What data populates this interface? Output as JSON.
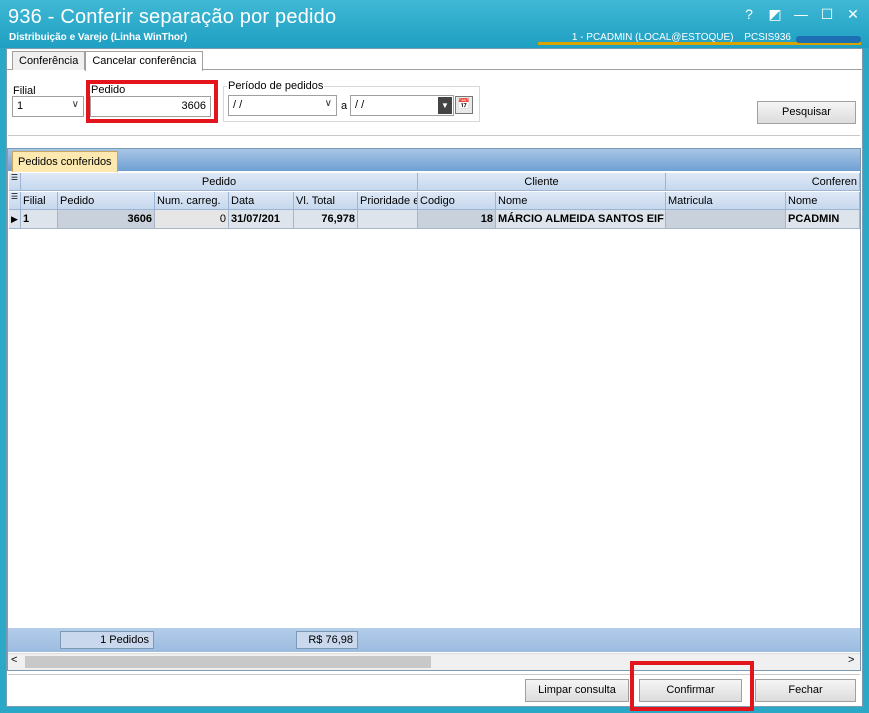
{
  "window": {
    "title": "936 - Conferir separação por pedido",
    "subtitle": "Distribuição e Varejo (Linha WinThor)",
    "user": "1 - PCADMIN (LOCAL@ESTOQUE)",
    "routine": "PCSIS936",
    "controls": {
      "help": "?",
      "restore": "◩",
      "minimize": "—",
      "maximize": "☐",
      "close": "✕"
    }
  },
  "tabs": [
    {
      "label": "Conferência",
      "active": false
    },
    {
      "label": "Cancelar conferência",
      "active": true
    }
  ],
  "filters": {
    "filial_label": "Filial",
    "filial_value": "1",
    "pedido_label": "Pedido",
    "pedido_value": "3606",
    "periodo_label": "Período de pedidos",
    "periodo_from": " / /",
    "periodo_sep": "a",
    "periodo_to": " / /",
    "search_button": "Pesquisar"
  },
  "grid": {
    "tab_label": "Pedidos conferidos",
    "bands": {
      "pedido": "Pedido",
      "cliente": "Cliente",
      "conferente": "Conferen"
    },
    "columns": [
      "Filial",
      "Pedido",
      "Num. carreg.",
      "Data",
      "Vl. Total",
      "Prioridade e",
      "Codigo",
      "Nome",
      "Matricula",
      "Nome"
    ],
    "rows": [
      [
        "1",
        "3606",
        "0",
        "31/07/201",
        "76,978",
        "",
        "18",
        "MÁRCIO ALMEIDA SANTOS EIF",
        "",
        "PCADMIN"
      ]
    ],
    "summary": {
      "count": "1 Pedidos",
      "total": "R$ 76,98"
    }
  },
  "buttons": {
    "limpar": "Limpar consulta",
    "confirmar": "Confirmar",
    "fechar": "Fechar"
  },
  "colors": {
    "titlebar": "#1f9fc2",
    "highlight": "#e3141b",
    "grid_header": "#c6d8ee"
  }
}
